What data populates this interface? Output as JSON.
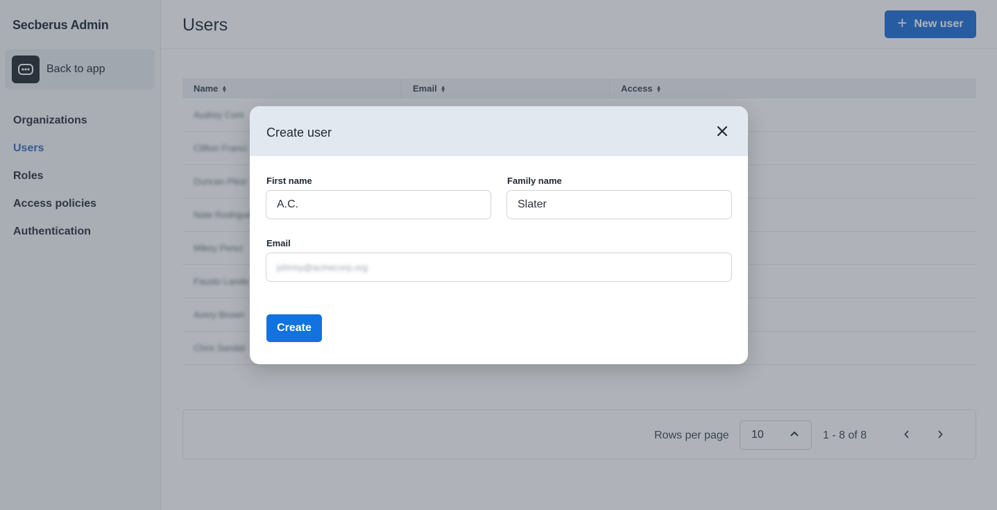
{
  "app": {
    "title": "Secberus Admin"
  },
  "sidebar": {
    "back_label": "Back to app",
    "items": [
      {
        "label": "Organizations",
        "active": false
      },
      {
        "label": "Users",
        "active": true
      },
      {
        "label": "Roles",
        "active": false
      },
      {
        "label": "Access policies",
        "active": false
      },
      {
        "label": "Authentication",
        "active": false
      }
    ]
  },
  "header": {
    "title": "Users",
    "new_user_label": "New user"
  },
  "table": {
    "columns": [
      "Name",
      "Email",
      "Access"
    ],
    "rows": [
      "Audrey Cont",
      "Clifton Franci",
      "Duncan Plexi",
      "Nate Rodrigue",
      "Mikey Perez",
      "Fausto Lande",
      "Avery Brown",
      "Chris Sandal"
    ]
  },
  "pagination": {
    "rows_label": "Rows per page",
    "rows_value": "10",
    "range": "1 - 8 of 8"
  },
  "modal": {
    "title": "Create user",
    "first_name_label": "First name",
    "first_name_value": "A.C.",
    "family_name_label": "Family name",
    "family_name_value": "Slater",
    "email_label": "Email",
    "email_placeholder": "johnny@acmecorp.org",
    "create_label": "Create"
  },
  "colors": {
    "accent": "#1172e0",
    "active_nav": "#2f6fc6",
    "overlay": "rgba(55,65,81,0.40)"
  }
}
